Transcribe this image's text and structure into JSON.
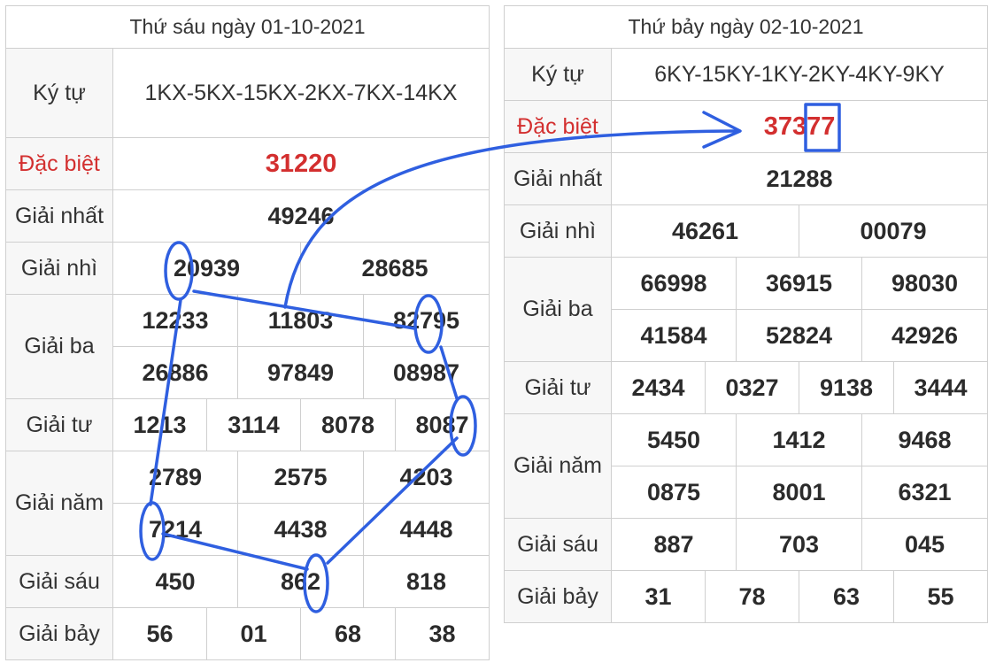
{
  "left": {
    "header": "Thứ sáu ngày 01-10-2021",
    "labels": {
      "kytu": "Ký tự",
      "db": "Đặc biệt",
      "nhat": "Giải nhất",
      "nhi": "Giải nhì",
      "ba": "Giải ba",
      "tu": "Giải tư",
      "nam": "Giải năm",
      "sau": "Giải sáu",
      "bay": "Giải bảy"
    },
    "kytu_value": "1KX-5KX-15KX-2KX-7KX-14KX",
    "dac_biet": "31220",
    "giai_nhat": "49246",
    "giai_nhi": [
      "20939",
      "28685"
    ],
    "giai_ba": [
      "12233",
      "11803",
      "82795",
      "26886",
      "97849",
      "08987"
    ],
    "giai_tu": [
      "1213",
      "3114",
      "8078",
      "8087"
    ],
    "giai_nam": [
      "2789",
      "2575",
      "4203",
      "7214",
      "4438",
      "4448"
    ],
    "giai_sau": [
      "450",
      "862",
      "818"
    ],
    "giai_bay": [
      "56",
      "01",
      "68",
      "38"
    ]
  },
  "right": {
    "header": "Thứ bảy ngày 02-10-2021",
    "labels": {
      "kytu": "Ký tự",
      "db": "Đặc biệt",
      "nhat": "Giải nhất",
      "nhi": "Giải nhì",
      "ba": "Giải ba",
      "tu": "Giải tư",
      "nam": "Giải năm",
      "sau": "Giải sáu",
      "bay": "Giải bảy"
    },
    "kytu_value": "6KY-15KY-1KY-2KY-4KY-9KY",
    "dac_biet": "37377",
    "giai_nhat": "21288",
    "giai_nhi": [
      "46261",
      "00079"
    ],
    "giai_ba": [
      "66998",
      "36915",
      "98030",
      "41584",
      "52824",
      "42926"
    ],
    "giai_tu": [
      "2434",
      "0327",
      "9138",
      "3444"
    ],
    "giai_nam": [
      "5450",
      "1412",
      "9468",
      "0875",
      "8001",
      "6321"
    ],
    "giai_sau": [
      "887",
      "703",
      "045"
    ],
    "giai_bay": [
      "31",
      "78",
      "63",
      "55"
    ]
  },
  "annotation": {
    "color": "#2f5fe0"
  }
}
